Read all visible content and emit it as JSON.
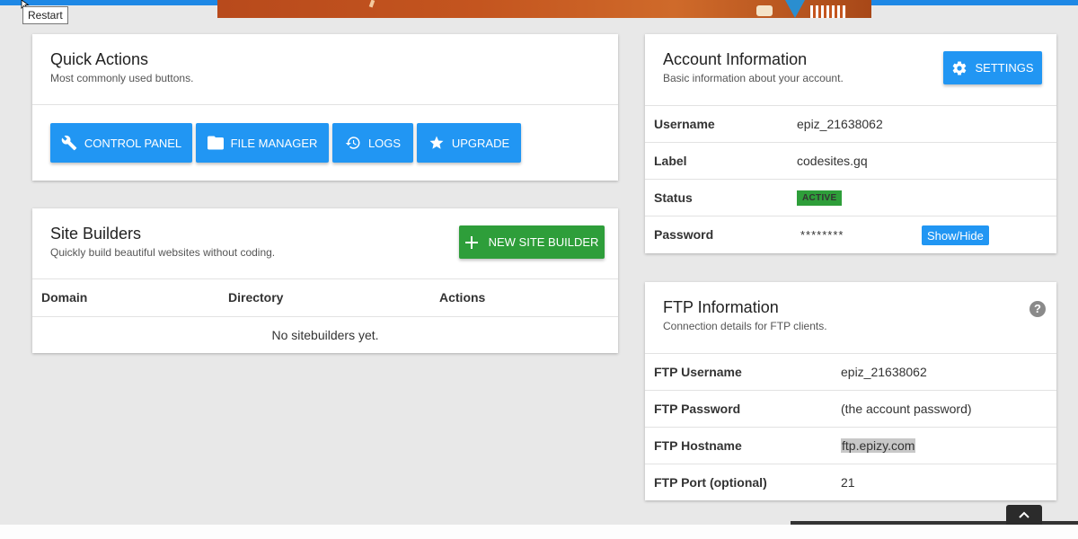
{
  "tooltip": {
    "text": "Restart"
  },
  "quick_actions": {
    "title": "Quick Actions",
    "subtitle": "Most commonly used buttons.",
    "buttons": [
      {
        "label": "CONTROL PANEL",
        "icon": "wrench-icon"
      },
      {
        "label": "FILE MANAGER",
        "icon": "folder-icon"
      },
      {
        "label": "LOGS",
        "icon": "history-icon"
      },
      {
        "label": "UPGRADE",
        "icon": "star-icon"
      }
    ]
  },
  "site_builders": {
    "title": "Site Builders",
    "subtitle": "Quickly build beautiful websites without coding.",
    "new_button": "NEW SITE BUILDER",
    "columns": [
      "Domain",
      "Directory",
      "Actions"
    ],
    "empty_text": "No sitebuilders yet."
  },
  "account": {
    "title": "Account Information",
    "subtitle": "Basic information about your account.",
    "settings_label": "SETTINGS",
    "rows": [
      {
        "label": "Username",
        "value": "epiz_21638062"
      },
      {
        "label": "Label",
        "value": "codesites.gq"
      },
      {
        "label": "Status",
        "value": "ACTIVE"
      },
      {
        "label": "Password",
        "value": "********"
      }
    ],
    "show_hide_label": "Show/Hide"
  },
  "ftp": {
    "title": "FTP Information",
    "subtitle": "Connection details for FTP clients.",
    "rows": [
      {
        "label": "FTP Username",
        "value": "epiz_21638062"
      },
      {
        "label": "FTP Password",
        "value": "(the account password)"
      },
      {
        "label": "FTP Hostname",
        "value": "ftp.epizy.com"
      },
      {
        "label": "FTP Port (optional)",
        "value": "21"
      }
    ]
  },
  "colors": {
    "primary": "#2196f3",
    "success": "#2e9e3a",
    "password": "#c2185b"
  }
}
